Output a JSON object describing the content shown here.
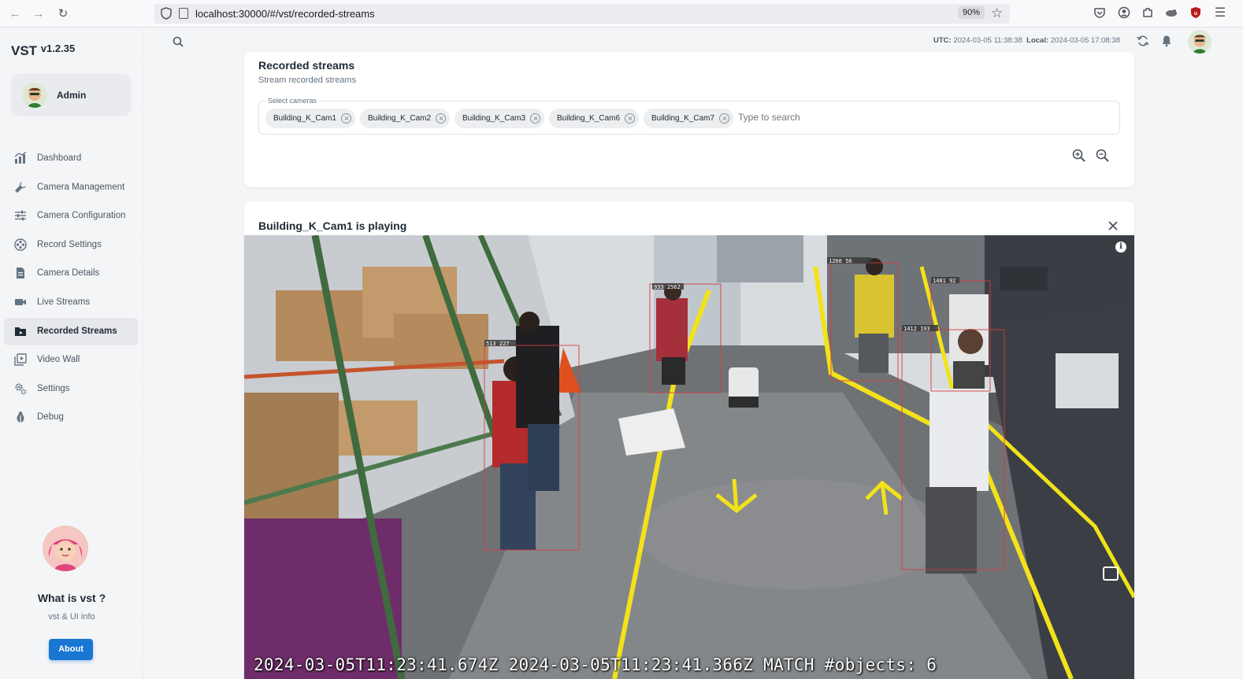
{
  "browser": {
    "url": "localhost:30000/#/vst/recorded-streams",
    "zoom": "90%",
    "icons": [
      "back-icon",
      "forward-icon",
      "reload-icon",
      "shield-icon",
      "page-icon",
      "star-icon",
      "pocket-icon",
      "account-icon",
      "extensions-icon",
      "extension-icon",
      "ublock-icon",
      "menu-icon"
    ]
  },
  "app": {
    "logo": "VST",
    "version": "v1.2.35",
    "user": "Admin"
  },
  "sidebar": {
    "items": [
      {
        "label": "Dashboard",
        "icon": "dashboard-icon",
        "active": false
      },
      {
        "label": "Camera Management",
        "icon": "wrench-icon",
        "active": false
      },
      {
        "label": "Camera Configuration",
        "icon": "sliders-icon",
        "active": false
      },
      {
        "label": "Record Settings",
        "icon": "film-reel-icon",
        "active": false
      },
      {
        "label": "Camera Details",
        "icon": "document-icon",
        "active": false
      },
      {
        "label": "Live Streams",
        "icon": "video-camera-icon",
        "active": false
      },
      {
        "label": "Recorded Streams",
        "icon": "folder-video-icon",
        "active": true
      },
      {
        "label": "Video Wall",
        "icon": "video-library-icon",
        "active": false
      },
      {
        "label": "Settings",
        "icon": "gears-icon",
        "active": false
      },
      {
        "label": "Debug",
        "icon": "bug-icon",
        "active": false
      }
    ],
    "promo_title": "What is vst ?",
    "promo_subtitle": "vst & UI info",
    "about_label": "About"
  },
  "header": {
    "utc_label": "UTC:",
    "utc_value": "2024-03-05 11:38:38",
    "local_label": "Local:",
    "local_value": "2024-03-05 17:08:38"
  },
  "recorded": {
    "title": "Recorded streams",
    "subtitle": "Stream recorded streams",
    "select_label": "Select cameras",
    "search_placeholder": "Type to search",
    "selected_cameras": [
      "Building_K_Cam1",
      "Building_K_Cam2",
      "Building_K_Cam3",
      "Building_K_Cam6",
      "Building_K_Cam7"
    ]
  },
  "player": {
    "title": "Building_K_Cam1 is playing",
    "osd_text": "2024-03-05T11:23:41.674Z  2024-03-05T11:23:41.366Z MATCH #objects: 6",
    "bbox_labels": [
      "513 227",
      "933 2562",
      "1260 50",
      "1481 92",
      "1412 193"
    ]
  },
  "colors": {
    "accent": "#1976d2",
    "active_bg": "#e6e8eb",
    "bbox": "#d23c3c",
    "floor_line": "#f2e21a"
  }
}
